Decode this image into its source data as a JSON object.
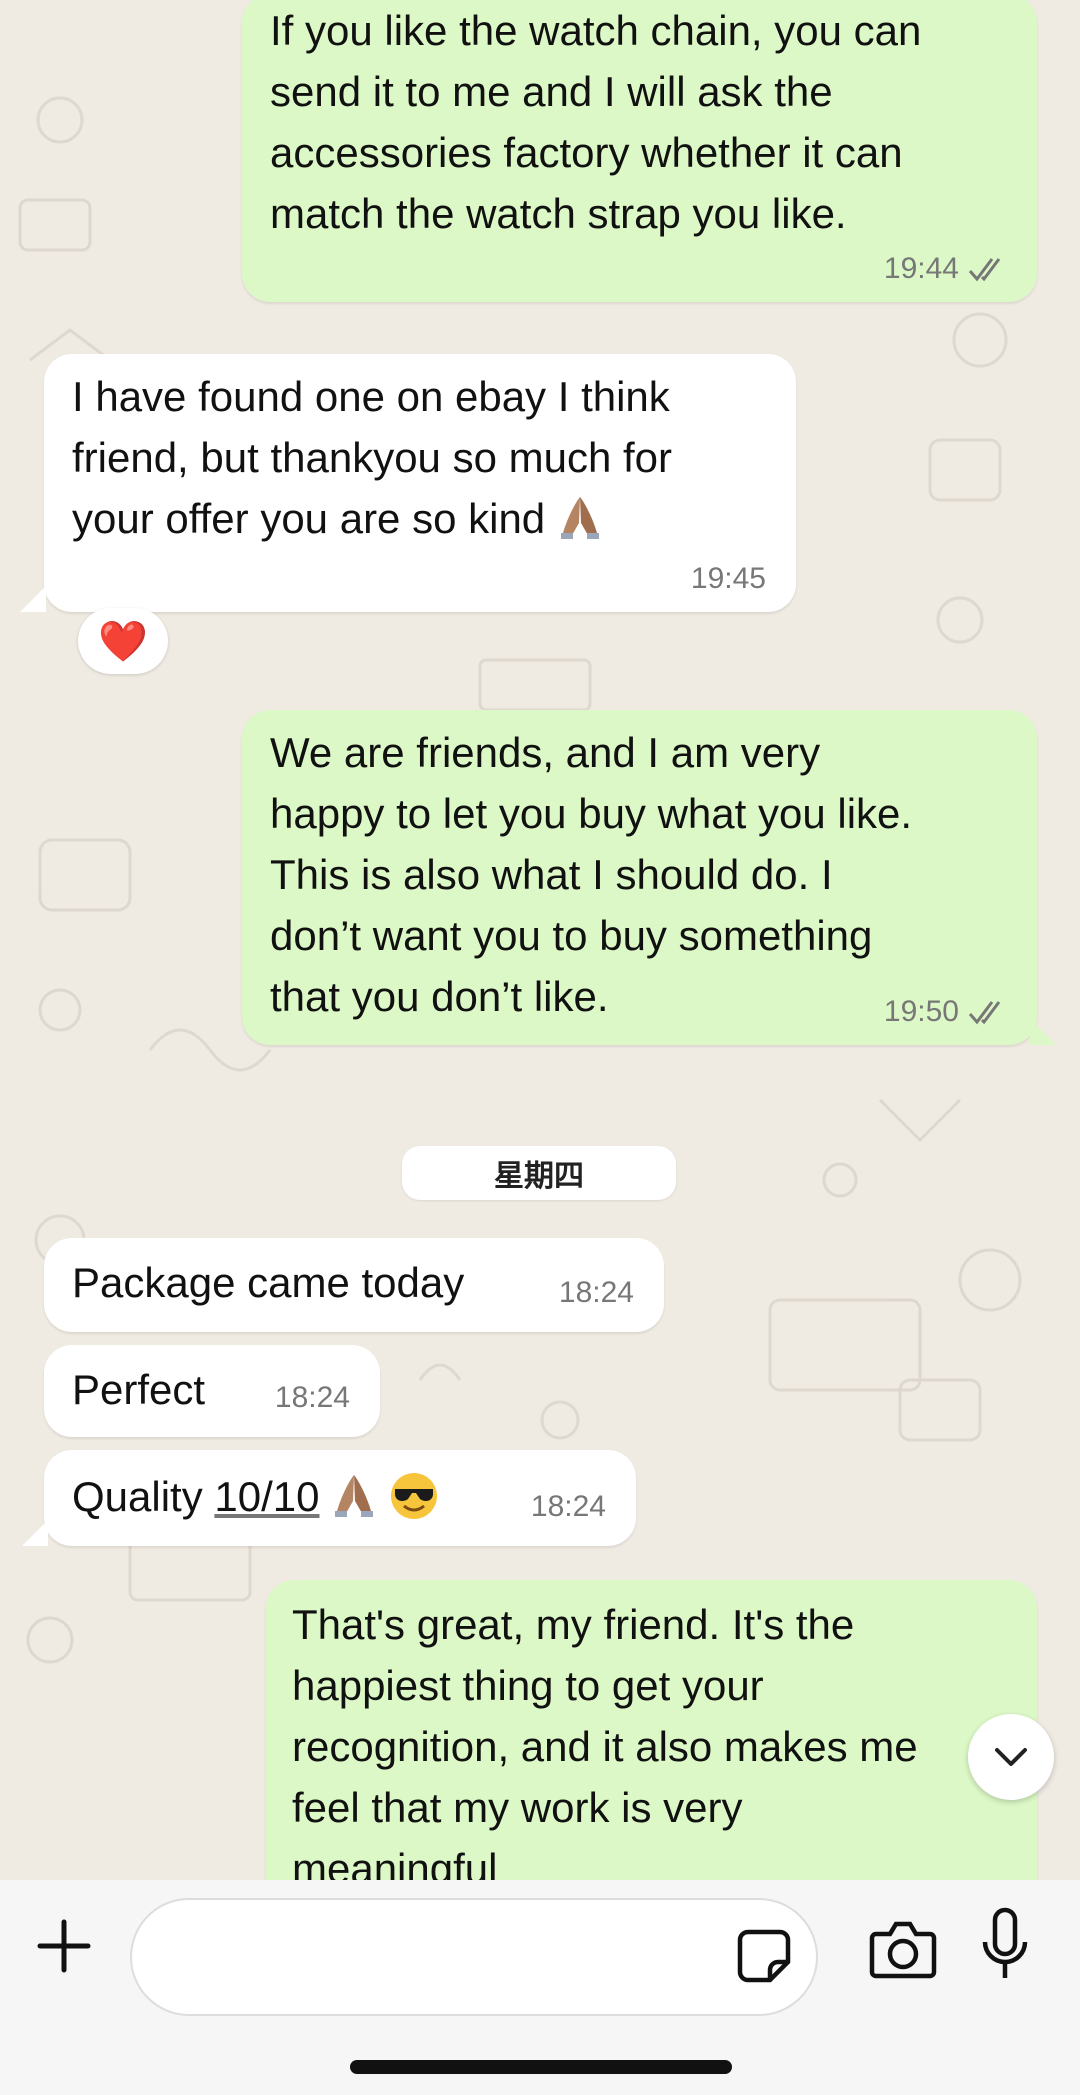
{
  "messages": [
    {
      "direction": "out",
      "text": "If you like the watch chain, you can\nsend it to me and I will ask the\naccessories factory whether it can\nmatch the watch strap you like.",
      "time": "19:44",
      "status": "read"
    },
    {
      "direction": "in",
      "text": "I have found one on ebay I think\nfriend, but thankyou so much for\nyour offer you are so kind",
      "emoji": [
        "folded-hands"
      ],
      "time": "19:45",
      "reaction": "❤️"
    },
    {
      "direction": "out",
      "text": "We are friends, and I am very\nhappy to let you buy what you like.\nThis is also what I should do. I\ndon’t want you to buy something\nthat you don’t like.",
      "time": "19:50",
      "status": "read"
    },
    {
      "direction": "in",
      "text": "Package came today",
      "time": "18:24"
    },
    {
      "direction": "in",
      "text": "Perfect",
      "time": "18:24"
    },
    {
      "direction": "in",
      "text_prefix": "Quality ",
      "text_underlined": "10/10",
      "emoji": [
        "folded-hands",
        "smiling-face-with-sunglasses"
      ],
      "time": "18:24"
    },
    {
      "direction": "out",
      "text": "That's great, my friend. It's the\nhappiest thing to get your\nrecognition, and it also makes me\nfeel that my work is very\nmeaningful"
    }
  ],
  "date_separator": "星期四",
  "composer": {
    "icons": [
      "plus-icon",
      "sticker-icon",
      "camera-icon",
      "microphone-icon"
    ]
  },
  "colors": {
    "outgoing_bubble": "#dcf8c6",
    "incoming_bubble": "#ffffff",
    "wallpaper": "#efeae2",
    "read_ticks": "#777777"
  }
}
